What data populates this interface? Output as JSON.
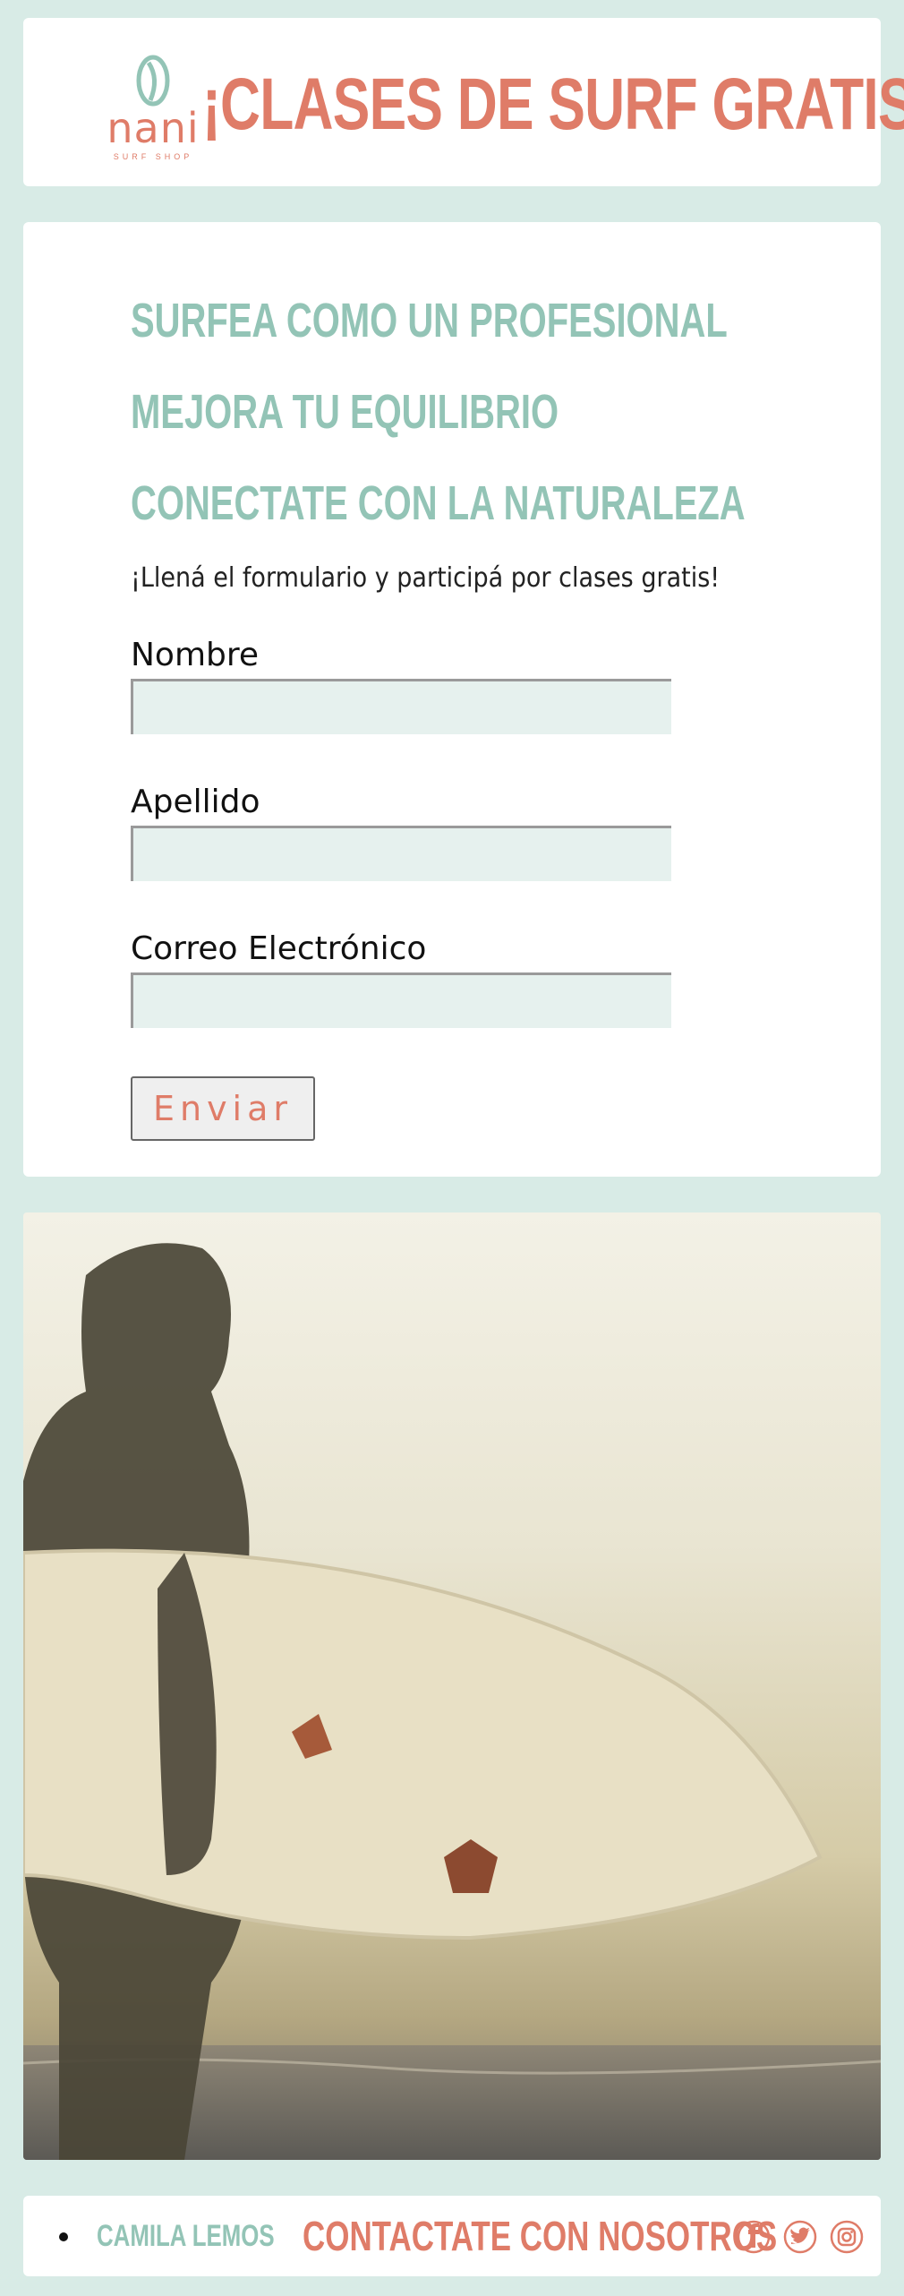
{
  "header": {
    "logo_word": "nani",
    "logo_sub": "SURF SHOP",
    "title": "¡CLASES DE SURF GRATIS!"
  },
  "form": {
    "benefits": [
      "SURFEA COMO UN PROFESIONAL",
      "MEJORA TU EQUILIBRIO",
      "CONECTATE CON LA NATURALEZA"
    ],
    "intro": "¡Llená el formulario y participá por clases gratis!",
    "fields": [
      {
        "label": "Nombre",
        "value": ""
      },
      {
        "label": "Apellido",
        "value": ""
      },
      {
        "label": "Correo Electrónico",
        "value": ""
      }
    ],
    "submit_label": "Enviar"
  },
  "footer": {
    "author": "CAMILA LEMOS",
    "contact": "CONTACTATE CON NOSOTROS",
    "socials": [
      "facebook-icon",
      "twitter-icon",
      "instagram-icon"
    ]
  },
  "colors": {
    "background": "#d8ebe6",
    "accent_coral": "#df7c68",
    "accent_mint": "#93c4b6",
    "field_fill": "#e6f1ee"
  }
}
